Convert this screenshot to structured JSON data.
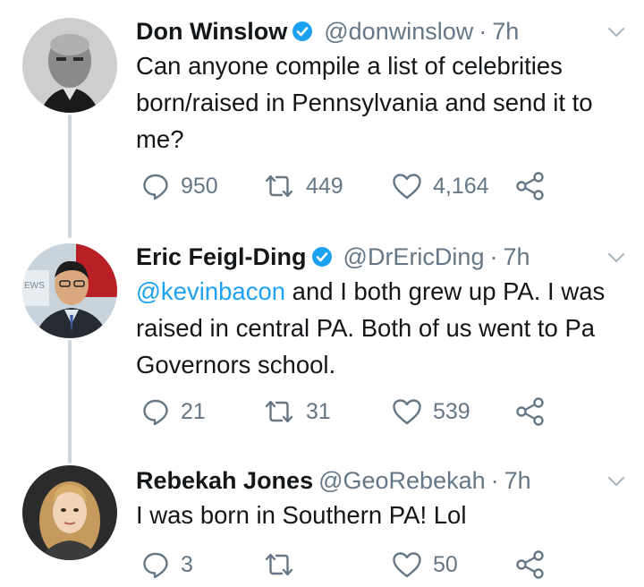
{
  "tweets": [
    {
      "name": "Don Winslow",
      "verified": true,
      "handle": "@donwinslow",
      "separator": "·",
      "time": "7h",
      "text": "Can anyone compile a list of celebrities born/raised in Pennsylvania and send it to me?",
      "replies": "950",
      "retweets": "449",
      "likes": "4,164"
    },
    {
      "name": "Eric Feigl-Ding",
      "verified": true,
      "handle": "@DrEricDing",
      "separator": "·",
      "time": "7h",
      "mention": "@kevinbacon",
      "text_after_mention": " and I both grew up PA. I was raised in central PA. Both of us went to Pa Governors school.",
      "avatar_background_text": "EWS",
      "replies": "21",
      "retweets": "31",
      "likes": "539"
    },
    {
      "name": "Rebekah Jones",
      "verified": false,
      "handle": "@GeoRebekah",
      "separator": "·",
      "time": "7h",
      "text": "I was born in Southern PA! Lol",
      "replies": "3",
      "retweets": "",
      "likes": "50"
    }
  ],
  "icons": {
    "verified": "verified-badge-icon",
    "more": "chevron-down-icon",
    "reply": "reply-icon",
    "retweet": "retweet-icon",
    "like": "heart-icon",
    "share": "share-icon"
  },
  "colors": {
    "text": "#14171a",
    "secondary": "#657786",
    "link": "#1da1f2",
    "thread_line": "#ccd6dd"
  }
}
